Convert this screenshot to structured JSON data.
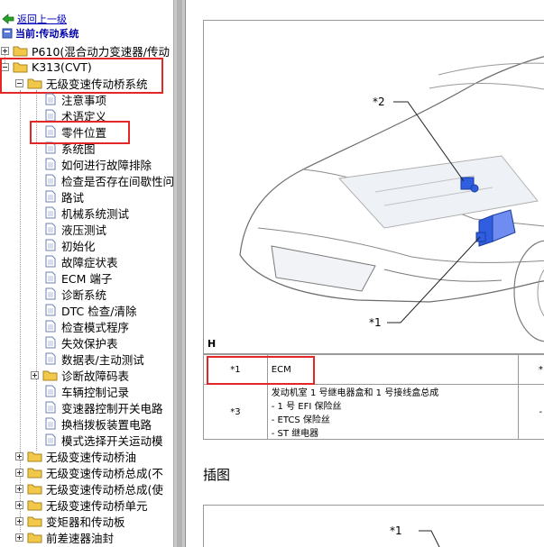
{
  "nav": {
    "back_label": "返回上一级",
    "current_label": "当前:传动系统"
  },
  "tree": {
    "p610": "P610(混合动力变速器/传动",
    "k313": "K313(CVT)",
    "cvt_system": "无级变速传动桥系统",
    "docs": [
      "注意事项",
      "术语定义",
      "零件位置",
      "系统图",
      "如何进行故障排除",
      "检查是否存在间歇性问",
      "路试",
      "机械系统测试",
      "液压测试",
      "初始化",
      "故障症状表",
      "ECM 端子",
      "诊断系统",
      "DTC 检查/清除",
      "检查模式程序",
      "失效保护表",
      "数据表/主动测试"
    ],
    "dtc_folder": "诊断故障码表",
    "docs2": [
      "车辆控制记录",
      "变速器控制开关电路",
      "换档拨板装置电路",
      "模式选择开关运动模"
    ],
    "folders": [
      "无级变速传动桥油",
      "无级变速传动桥总成(不",
      "无级变速传动桥总成(使",
      "无级变速传动桥单元",
      "变矩器和传动板",
      "前差速器油封"
    ]
  },
  "figure": {
    "callout_2": "*2",
    "callout_1": "*1",
    "view_letter": "H"
  },
  "table": {
    "r1_num": "*1",
    "r1_name": "ECM",
    "r1_next": "*",
    "r2_num": "*3",
    "r2_line1": "发动机室 1 号继电器盒和 1 号接线盒总成",
    "r2_line2": "- 1 号 EFI 保险丝",
    "r2_line3": "- ETCS 保险丝",
    "r2_line4": "- ST 继电器",
    "r2_next": "-"
  },
  "section_title": "插图",
  "figure2": {
    "callout_1": "*1"
  },
  "colors": {
    "highlight": "#e32626",
    "link": "#0000bb",
    "folder": "#f2c84b",
    "ecu_blue": "#2f5fe0"
  }
}
